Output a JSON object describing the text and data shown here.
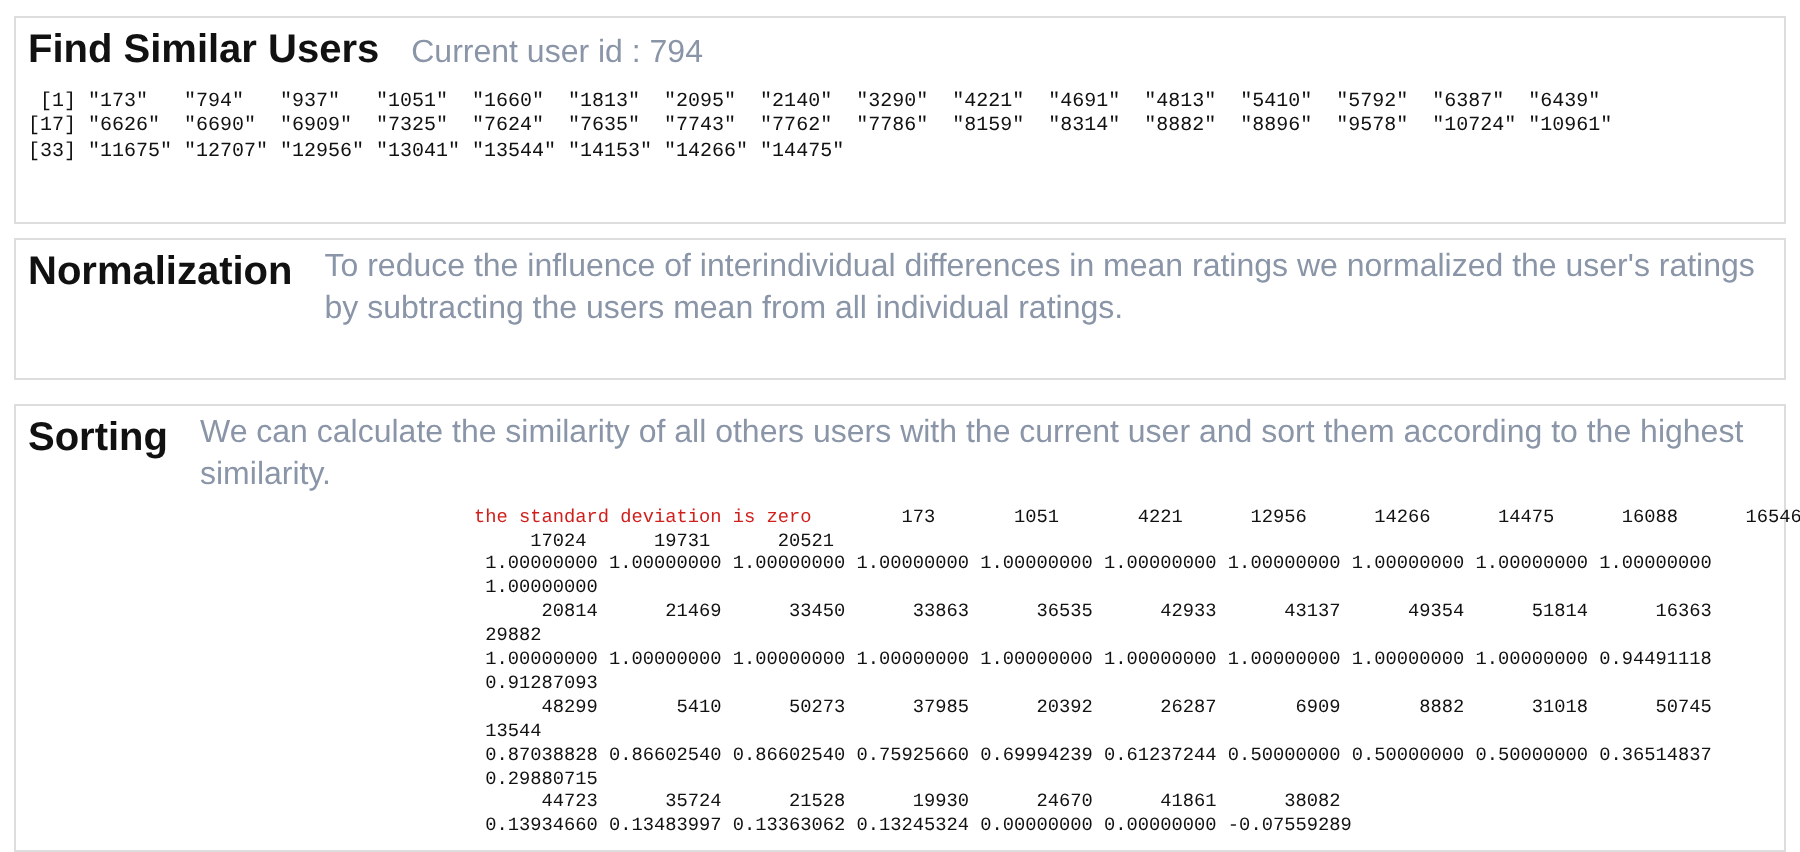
{
  "sections": [
    {
      "kind": "output",
      "title": "Find Similar Users",
      "subtitle": "Current user id : 794",
      "output_lines": [
        " [1] \"173\"   \"794\"   \"937\"   \"1051\"  \"1660\"  \"1813\"  \"2095\"  \"2140\"  \"3290\"  \"4221\"  \"4691\"  \"4813\"  \"5410\"  \"5792\"  \"6387\"  \"6439\"",
        "[17] \"6626\"  \"6690\"  \"6909\"  \"7325\"  \"7624\"  \"7635\"  \"7743\"  \"7762\"  \"7786\"  \"8159\"  \"8314\"  \"8882\"  \"8896\"  \"9578\"  \"10724\" \"10961\"",
        "[33] \"11675\" \"12707\" \"12956\" \"13041\" \"13544\" \"14153\" \"14266\" \"14475\""
      ]
    },
    {
      "kind": "text",
      "title": "Normalization",
      "description": "To reduce the influence of interindividual differences in mean ratings we normalized the user's ratings by subtracting the users mean from all individual ratings."
    },
    {
      "kind": "warning_output",
      "title": "Sorting",
      "description": "We can calculate the similarity of all others users with the current user and sort them according to the highest similarity.",
      "warning": "the standard deviation is zero",
      "first_line": "        173       1051       4221      12956      14266      14475      16088      16546",
      "output_lines": [
        "     17024      19731      20521",
        " 1.00000000 1.00000000 1.00000000 1.00000000 1.00000000 1.00000000 1.00000000 1.00000000 1.00000000 1.00000000",
        " 1.00000000",
        "      20814      21469      33450      33863      36535      42933      43137      49354      51814      16363",
        " 29882",
        " 1.00000000 1.00000000 1.00000000 1.00000000 1.00000000 1.00000000 1.00000000 1.00000000 1.00000000 0.94491118",
        " 0.91287093",
        "      48299       5410      50273      37985      20392      26287       6909       8882      31018      50745",
        " 13544",
        " 0.87038828 0.86602540 0.86602540 0.75925660 0.69994239 0.61237244 0.50000000 0.50000000 0.50000000 0.36514837",
        " 0.29880715",
        "      44723      35724      21528      19930      24670      41861      38082",
        " 0.13934660 0.13483997 0.13363062 0.13245324 0.00000000 0.00000000 -0.07559289"
      ]
    }
  ]
}
